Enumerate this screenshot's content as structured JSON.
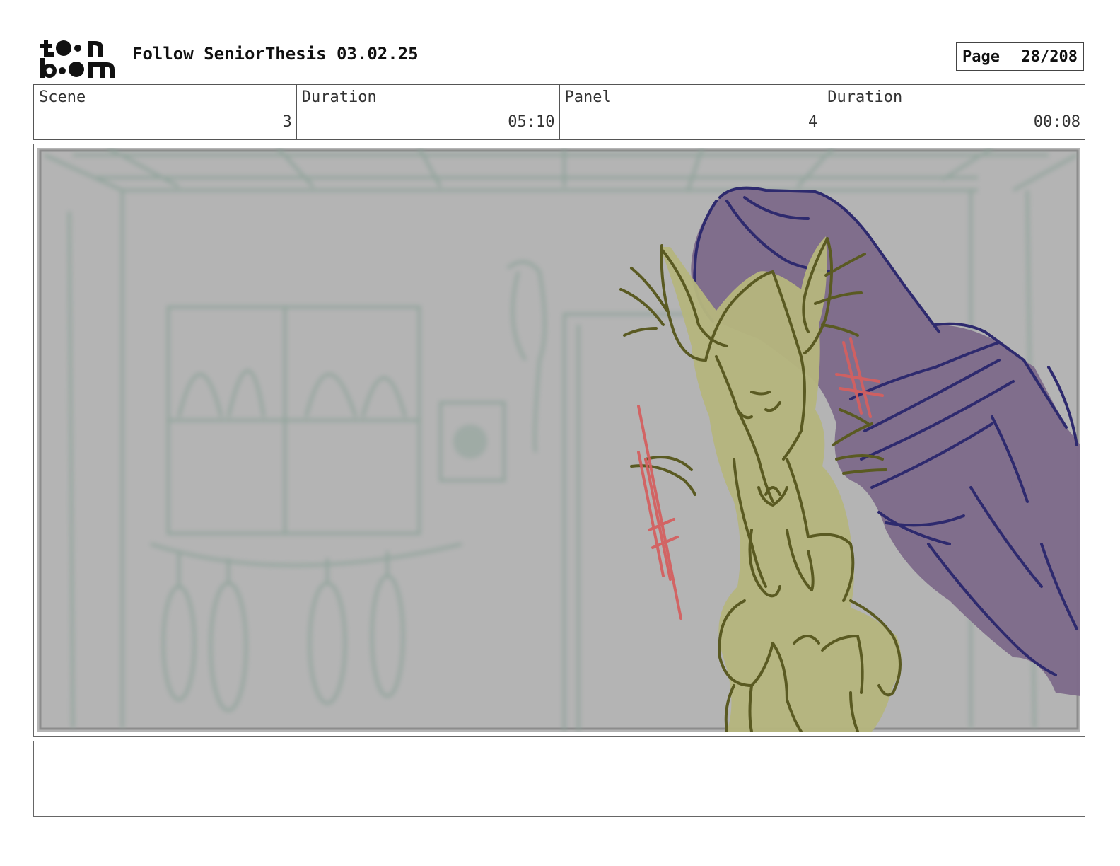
{
  "header": {
    "logo_text": "toon boom",
    "title": "Follow SeniorThesis 03.02.25",
    "page_label": "Page",
    "page_value": "28/208"
  },
  "info": {
    "scene_label": "Scene",
    "scene_value": "3",
    "scene_duration_label": "Duration",
    "scene_duration_value": "05:10",
    "panel_label": "Panel",
    "panel_value": "4",
    "panel_duration_label": "Duration",
    "panel_duration_value": "00:08"
  },
  "notes": {
    "text": ""
  },
  "colors": {
    "background_gray": "#b4b4b4",
    "creature_fill": "#b5b57e",
    "creature_line": "#5a5a22",
    "sleeve_fill": "#7d6a8a",
    "sleeve_line": "#2e2a6e",
    "accent_red": "#d46060",
    "background_line": "#8ea39a"
  }
}
